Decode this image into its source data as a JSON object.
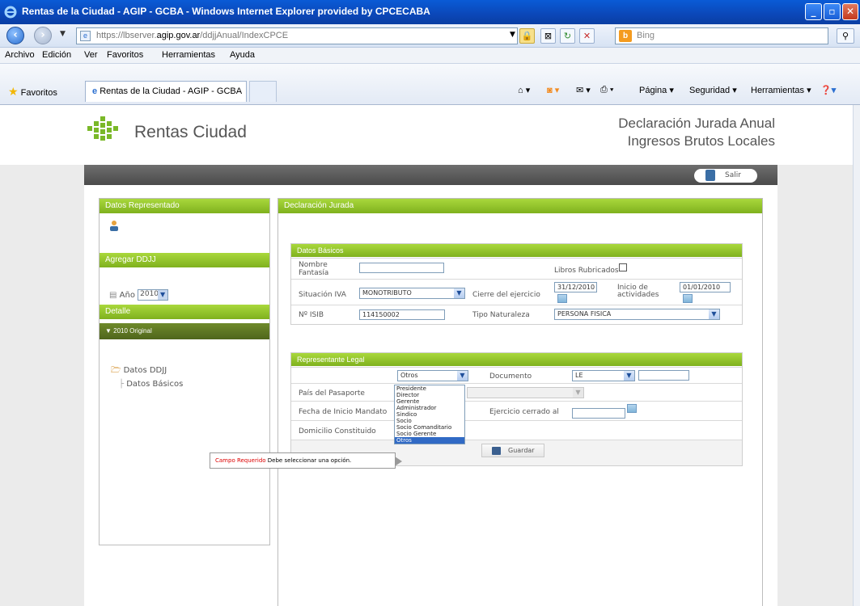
{
  "window": {
    "title": "Rentas de la Ciudad - AGIP - GCBA - Windows Internet Explorer provided by CPCECABA"
  },
  "address": {
    "url_prefix": "https://",
    "url_host_a": "lbserver.",
    "url_host_b": "agip.gov.ar",
    "url_path": "/ddjjAnual/IndexCPCE",
    "search_placeholder": "Bing"
  },
  "menu": [
    "Archivo",
    "Edición",
    "Ver",
    "Favoritos",
    "Herramientas",
    "Ayuda"
  ],
  "favbar": {
    "favorites": "Favoritos",
    "tab_title": "Rentas de la Ciudad - AGIP - GCBA",
    "pagina": "Página",
    "seguridad": "Seguridad",
    "herramientas": "Herramientas"
  },
  "site": {
    "logo": "Rentas Ciudad",
    "title_line1": "Declaración Jurada Anual",
    "title_line2": "Ingresos Brutos Locales",
    "salir": "Salir"
  },
  "left": {
    "datos_representado": "Datos Representado",
    "agregar_ddjj": "Agregar DDJJ",
    "anio_label": "Año",
    "anio_value": "2010",
    "detalle": "Detalle",
    "original": "▼ 2010 Original",
    "tree_folder": "Datos DDJJ",
    "tree_item": "Datos Básicos"
  },
  "main": {
    "title": "Declaración Jurada",
    "basicos": {
      "header": "Datos Básicos",
      "nombre_fantasia": "Nombre Fantasía",
      "libros_rubricados": "Libros Rubricados",
      "situacion_iva": "Situación IVA",
      "situacion_iva_value": "MONOTRIBUTO",
      "cierre_ejercicio": "Cierre del ejercicio",
      "cierre_value": "31/12/2010",
      "inicio_actividades": "Inicio de actividades",
      "inicio_value": "01/01/2010",
      "nro_isib": "Nº ISIB",
      "nro_isib_value": "114150002",
      "tipo_naturaleza": "Tipo Naturaleza",
      "tipo_naturaleza_value": "PERSONA FISICA"
    },
    "representante": {
      "header": "Representante Legal",
      "cargo_value": "Otros",
      "documento": "Documento",
      "documento_value": "LE",
      "pais_pasaporte": "País del Pasaporte",
      "fecha_inicio_mandato": "Fecha de Inicio Mandato",
      "ejercicio_cerrado": "Ejercicio cerrado al",
      "domicilio": "Domicilio Constituido",
      "guardar": "Guardar"
    },
    "tooltip_required": "Campo Requerido",
    "tooltip_text": "Debe seleccionar una opción.",
    "dropdown_options": [
      "Presidente",
      "Director",
      "Gerente",
      "Administrador",
      "Sindico",
      "Socio",
      "Socio Comanditario",
      "Socio Gerente",
      "Otros"
    ]
  }
}
